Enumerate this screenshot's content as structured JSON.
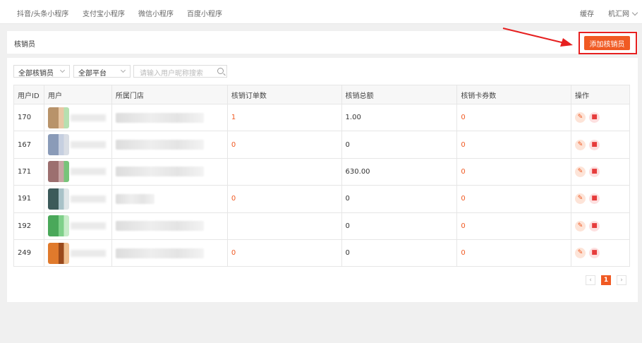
{
  "topnav": {
    "tabs": [
      "抖音/头条小程序",
      "支付宝小程序",
      "微信小程序",
      "百度小程序"
    ],
    "cache": "缓存",
    "user": "机汇网"
  },
  "header": {
    "title": "核销员",
    "add_button": "添加核销员"
  },
  "filters": {
    "staff_select": "全部核销员",
    "platform_select": "全部平台",
    "search_placeholder": "请输入用户昵称搜索"
  },
  "table": {
    "columns": [
      "用户ID",
      "用户",
      "所属门店",
      "核销订单数",
      "核销总额",
      "核销卡券数",
      "操作"
    ],
    "rows": [
      {
        "id": "170",
        "orders": "1",
        "total": "1.00",
        "coupons": "0"
      },
      {
        "id": "167",
        "orders": "0",
        "total": "0",
        "coupons": "0"
      },
      {
        "id": "171",
        "orders": "",
        "total": "630.00",
        "coupons": "0"
      },
      {
        "id": "191",
        "orders": "0",
        "total": "0",
        "coupons": "0"
      },
      {
        "id": "192",
        "orders": "",
        "total": "0",
        "coupons": "0"
      },
      {
        "id": "249",
        "orders": "0",
        "total": "0",
        "coupons": "0"
      }
    ]
  },
  "pagination": {
    "current": "1"
  },
  "colors": {
    "accent": "#f05a23",
    "highlight": "#e62020"
  },
  "icons": {
    "edit": "pencil-icon",
    "delete": "trash-icon"
  }
}
